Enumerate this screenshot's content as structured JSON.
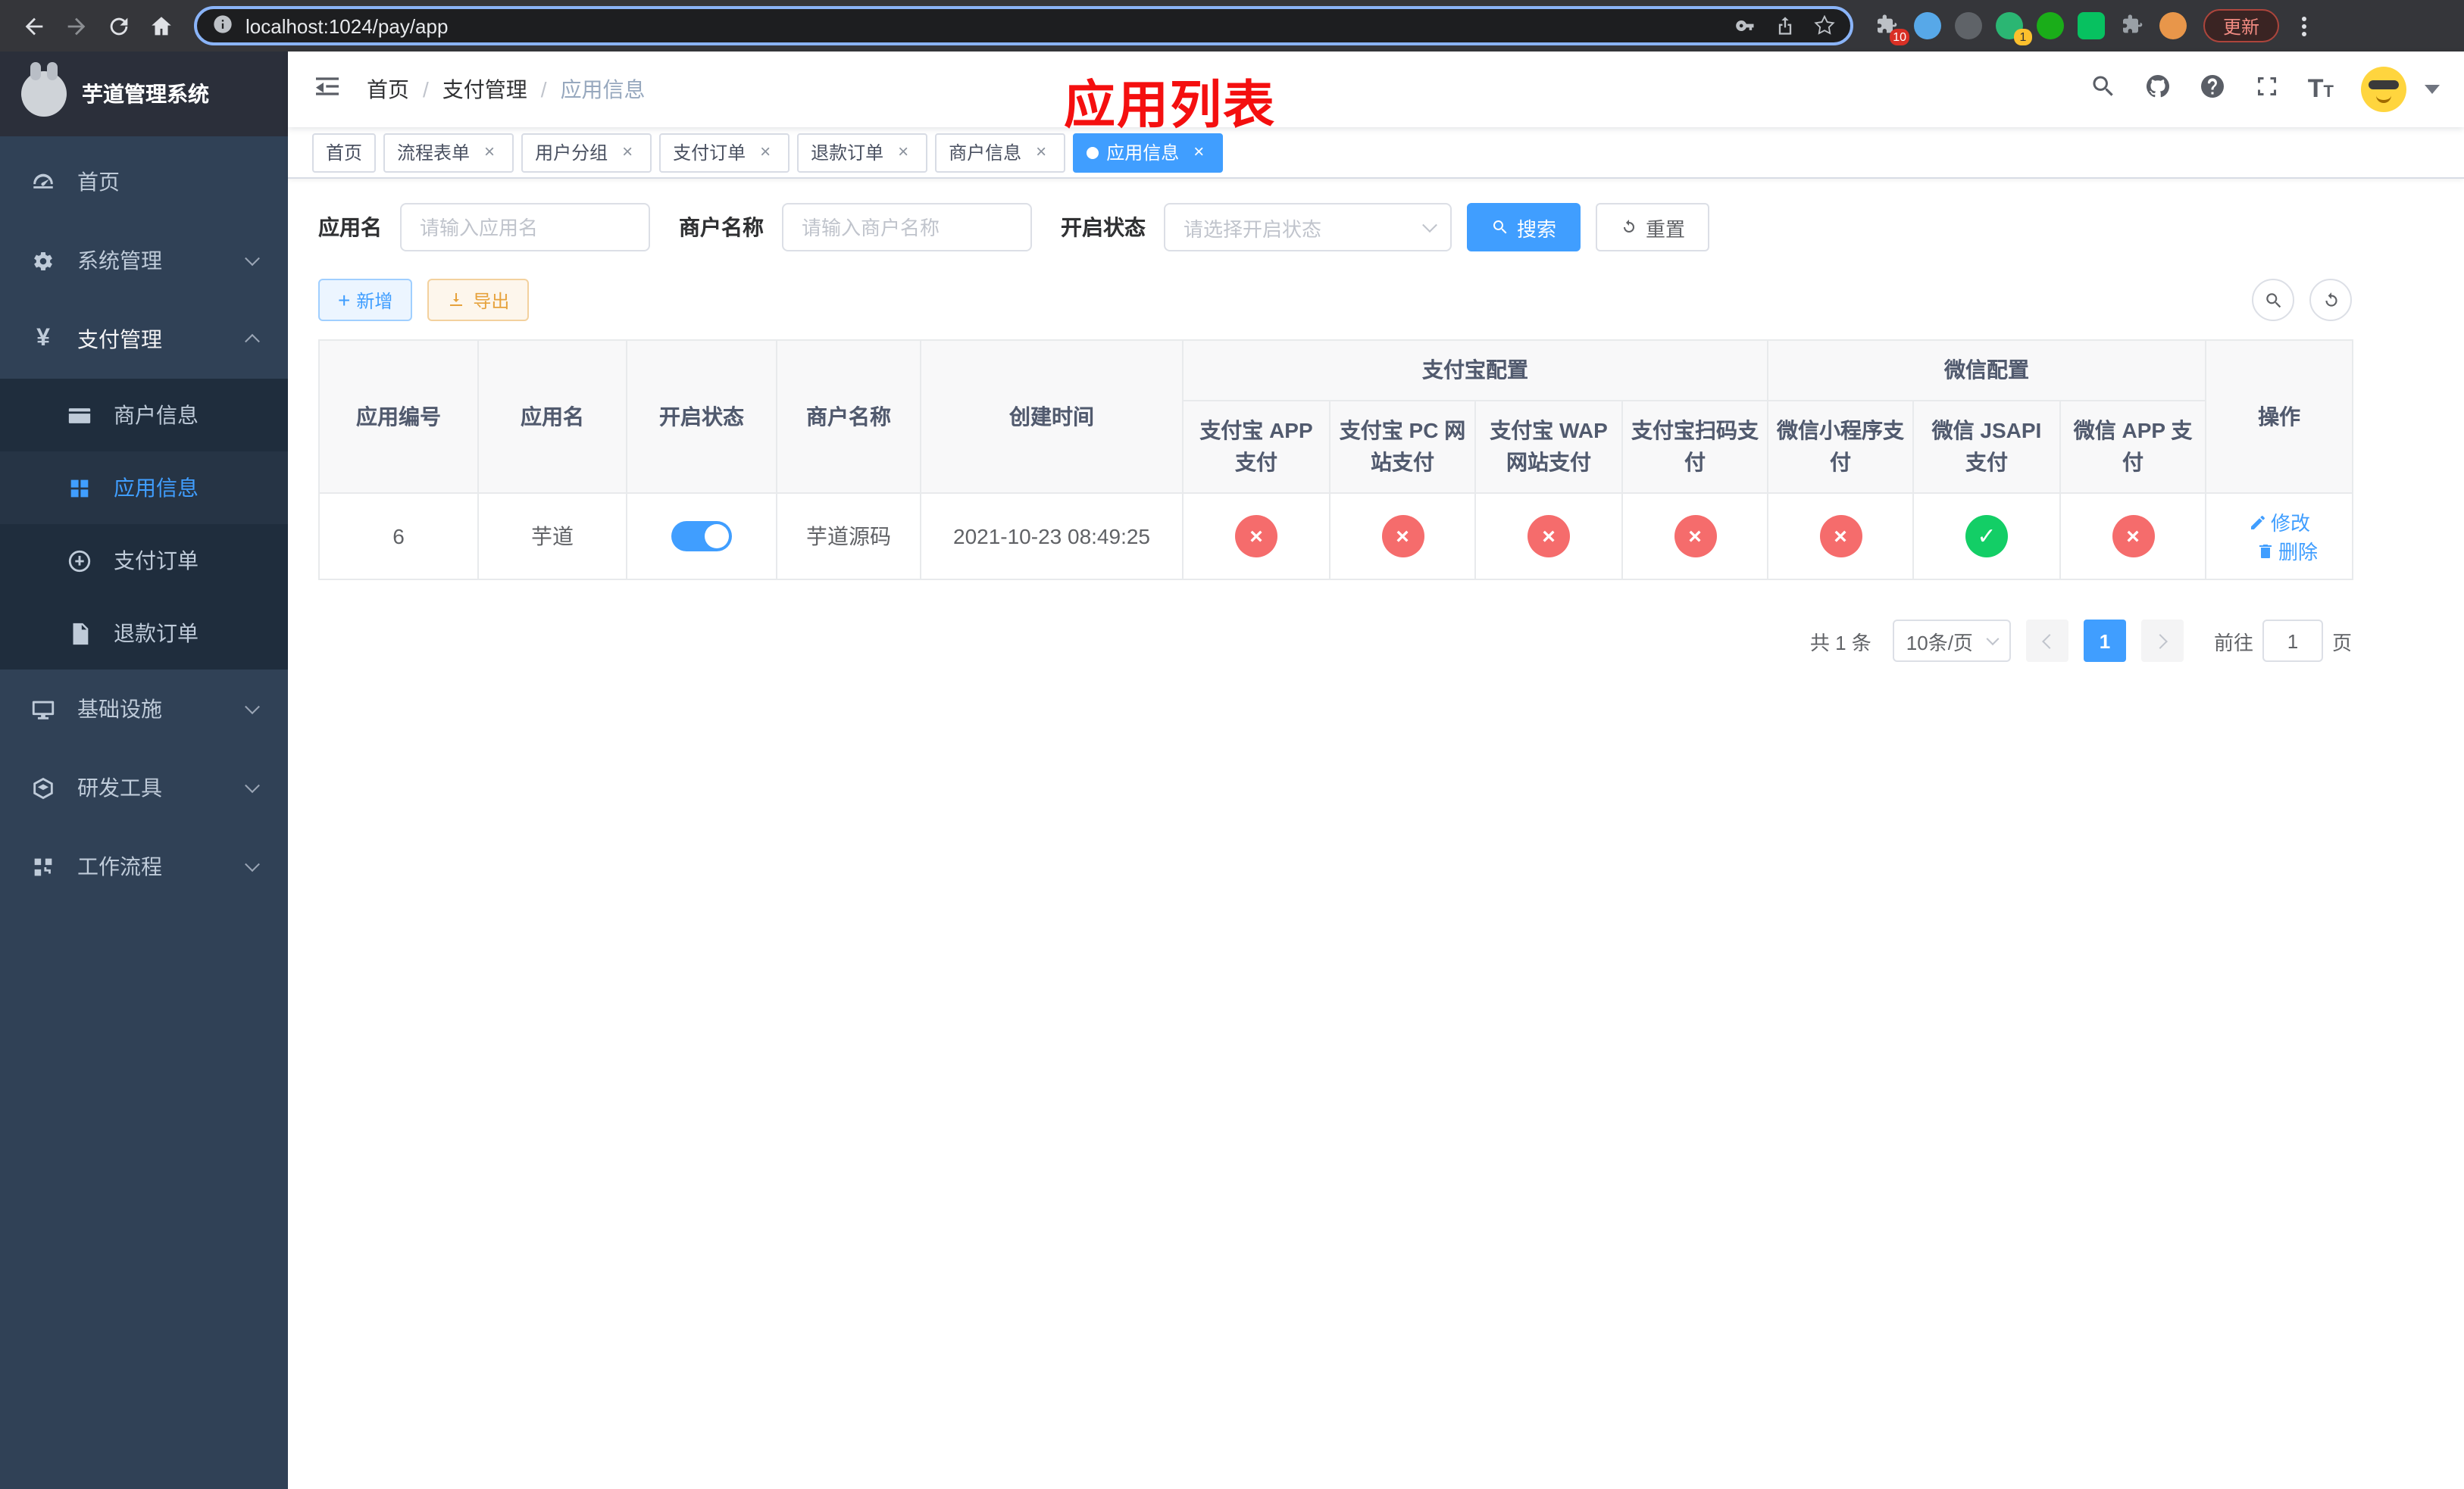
{
  "colors": {
    "primary": "#409eff",
    "success": "#13ce66",
    "danger": "#f56c6c",
    "warning": "#e6a23c",
    "annotation_red": "#f40f0f",
    "sidebar_bg": "#304156",
    "submenu_bg": "#1f2d3d"
  },
  "browser": {
    "url": "localhost:1024/pay/app",
    "update_label": "更新",
    "extension_badge_puzzle": "10",
    "extension_badge_green": "1"
  },
  "sidebar": {
    "app_title": "芋道管理系统",
    "items": [
      {
        "label": "首页"
      },
      {
        "label": "系统管理"
      },
      {
        "label": "支付管理",
        "children": [
          {
            "label": "商户信息"
          },
          {
            "label": "应用信息"
          },
          {
            "label": "支付订单"
          },
          {
            "label": "退款订单"
          }
        ]
      },
      {
        "label": "基础设施"
      },
      {
        "label": "研发工具"
      },
      {
        "label": "工作流程"
      }
    ]
  },
  "header": {
    "breadcrumb": [
      "首页",
      "支付管理",
      "应用信息"
    ],
    "annotation_title": "应用列表"
  },
  "tabs": [
    {
      "label": "首页"
    },
    {
      "label": "流程表单"
    },
    {
      "label": "用户分组"
    },
    {
      "label": "支付订单"
    },
    {
      "label": "退款订单"
    },
    {
      "label": "商户信息"
    },
    {
      "label": "应用信息"
    }
  ],
  "filters": {
    "app_name_label": "应用名",
    "app_name_placeholder": "请输入应用名",
    "merchant_label": "商户名称",
    "merchant_placeholder": "请输入商户名称",
    "status_label": "开启状态",
    "status_placeholder": "请选择开启状态",
    "search_label": "搜索",
    "reset_label": "重置"
  },
  "toolbar": {
    "add_label": "新增",
    "export_label": "导出"
  },
  "table": {
    "columns": {
      "id": "应用编号",
      "name": "应用名",
      "status": "开启状态",
      "merchant": "商户名称",
      "created": "创建时间",
      "alipay_group": "支付宝配置",
      "wechat_group": "微信配置",
      "alipay": [
        "支付宝 APP 支付",
        "支付宝 PC 网站支付",
        "支付宝 WAP 网站支付",
        "支付宝扫码支付"
      ],
      "wechat": [
        "微信小程序支付",
        "微信 JSAPI 支付",
        "微信 APP 支付"
      ],
      "actions": "操作"
    },
    "actions": {
      "edit": "修改",
      "delete": "删除"
    },
    "rows": [
      {
        "id": "6",
        "name": "芋道",
        "status_on": true,
        "merchant": "芋道源码",
        "created": "2021-10-23 08:49:25",
        "configs": [
          "no",
          "no",
          "no",
          "no",
          "no",
          "yes",
          "no"
        ]
      }
    ]
  },
  "pagination": {
    "total": "共 1 条",
    "page_size": "10条/页",
    "page": "1",
    "goto_label": "前往",
    "goto_value": "1",
    "page_unit": "页"
  }
}
